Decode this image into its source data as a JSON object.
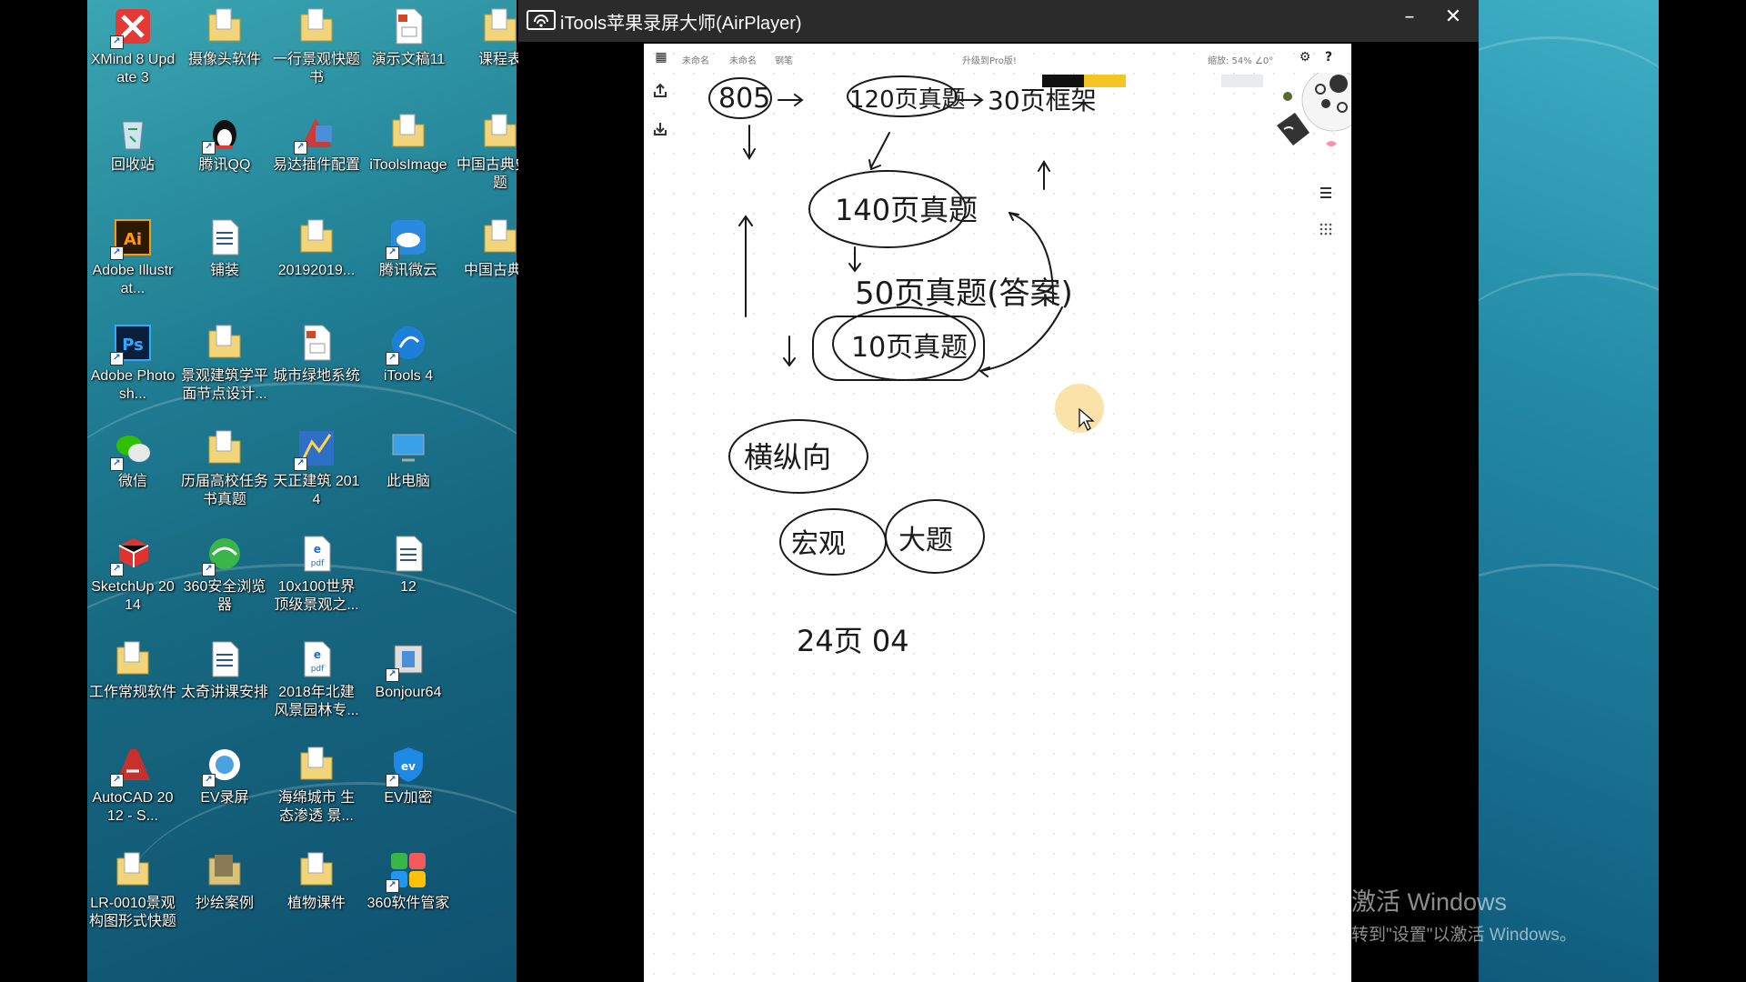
{
  "desktop": {
    "icons": [
      {
        "label": "XMind 8 Update 3",
        "icon": "xmind-icon",
        "color": "#e53935"
      },
      {
        "label": "摄像头软件",
        "icon": "folder-icon",
        "color": "#f2d47a"
      },
      {
        "label": "一行景观快题书",
        "icon": "folder-icon",
        "color": "#f2d47a"
      },
      {
        "label": "演示文稿11",
        "icon": "powerpoint-doc-icon",
        "color": "#d24726"
      },
      {
        "label": "课程表",
        "icon": "folder-icon",
        "color": "#f2d47a"
      },
      {
        "label": "回收站",
        "icon": "recycle-bin-icon",
        "color": "#cfe3f0"
      },
      {
        "label": "腾讯QQ",
        "icon": "qq-penguin-icon",
        "color": "#111111"
      },
      {
        "label": "易达插件配置",
        "icon": "yida-plugin-icon",
        "color": "#c83c3c"
      },
      {
        "label": "iToolsImage",
        "icon": "folder-icon",
        "color": "#f2d47a"
      },
      {
        "label": "中国古典史真题",
        "icon": "folder-icon",
        "color": "#f2d47a"
      },
      {
        "label": "Adobe Illustrat...",
        "icon": "illustrator-icon",
        "color": "#2b1a00"
      },
      {
        "label": "铺装",
        "icon": "word-doc-icon",
        "color": "#2b579a"
      },
      {
        "label": "20192019...",
        "icon": "folder-icon",
        "color": "#f2d47a"
      },
      {
        "label": "腾讯微云",
        "icon": "weiyun-cloud-icon",
        "color": "#2a8ae0"
      },
      {
        "label": "中国古典史",
        "icon": "folder-icon",
        "color": "#f2d47a"
      },
      {
        "label": "Adobe Photosh...",
        "icon": "photoshop-icon",
        "color": "#0a1f3a"
      },
      {
        "label": "景观建筑学平面节点设计...",
        "icon": "folder-icon",
        "color": "#f2d47a"
      },
      {
        "label": "城市绿地系统",
        "icon": "powerpoint-doc-icon",
        "color": "#d24726"
      },
      {
        "label": "iTools 4",
        "icon": "itools-icon",
        "color": "#1e7fd8"
      },
      {
        "label": "",
        "icon": "",
        "color": ""
      },
      {
        "label": "微信",
        "icon": "wechat-icon",
        "color": "#2dc100"
      },
      {
        "label": "历届高校任务书真题",
        "icon": "folder-icon",
        "color": "#f2d47a"
      },
      {
        "label": "天正建筑 2014",
        "icon": "tangent-arch-icon",
        "color": "#2f6fc6"
      },
      {
        "label": "此电脑",
        "icon": "this-pc-icon",
        "color": "#3aa0e8"
      },
      {
        "label": "",
        "icon": "",
        "color": ""
      },
      {
        "label": "SketchUp 2014",
        "icon": "sketchup-icon",
        "color": "#e0322e"
      },
      {
        "label": "360安全浏览器",
        "icon": "browser-360-icon",
        "color": "#3ab54a"
      },
      {
        "label": "10x100世界顶级景观之...",
        "icon": "pdf-doc-icon",
        "color": "#1f6fc2"
      },
      {
        "label": "12",
        "icon": "word-doc-icon",
        "color": "#2b579a"
      },
      {
        "label": "",
        "icon": "",
        "color": ""
      },
      {
        "label": "工作常规软件",
        "icon": "folder-icon",
        "color": "#f2d47a"
      },
      {
        "label": "太奇讲课安排",
        "icon": "word-doc-icon",
        "color": "#2b579a"
      },
      {
        "label": "2018年北建风景园林专...",
        "icon": "pdf-doc-icon",
        "color": "#1f6fc2"
      },
      {
        "label": "Bonjour64",
        "icon": "installer-icon",
        "color": "#6a6a6a"
      },
      {
        "label": "",
        "icon": "",
        "color": ""
      },
      {
        "label": "AutoCAD 2012 - S...",
        "icon": "autocad-icon",
        "color": "#c8302c"
      },
      {
        "label": "EV录屏",
        "icon": "ev-recorder-icon",
        "color": "#4aa3df"
      },
      {
        "label": "海绵城市 生态渗透 景...",
        "icon": "folder-icon",
        "color": "#f2d47a"
      },
      {
        "label": "EV加密",
        "icon": "ev-encrypt-icon",
        "color": "#1e88e5"
      },
      {
        "label": "",
        "icon": "",
        "color": ""
      },
      {
        "label": "LR-0010景观构图形式快题",
        "icon": "folder-icon",
        "color": "#f2d47a"
      },
      {
        "label": "抄绘案例",
        "icon": "folder-photo-icon",
        "color": "#8a7a55"
      },
      {
        "label": "植物课件",
        "icon": "folder-icon",
        "color": "#f2d47a"
      },
      {
        "label": "360软件管家",
        "icon": "software-manager-360-icon",
        "color": "#f35b5b"
      }
    ]
  },
  "airplayer": {
    "title": "iTools苹果录屏大师(AirPlayer)",
    "minimize_glyph": "–",
    "close_glyph": "✕"
  },
  "notes_app": {
    "toolbar": {
      "tab1": "未命名",
      "tab2": "未命名",
      "tool": "钢笔",
      "upgrade": "升级到Pro版!",
      "zoom": "缩放: 54% ∠0°"
    },
    "handwriting": [
      "805",
      "120页真题",
      "30页框架",
      "140页真题",
      "50页真题(答案)",
      "10页真题",
      "横纵向",
      "宏观",
      "大题",
      "24页 04"
    ]
  },
  "watermark": {
    "line1": "激活 Windows",
    "line2": "转到\"设置\"以激活 Windows。"
  }
}
